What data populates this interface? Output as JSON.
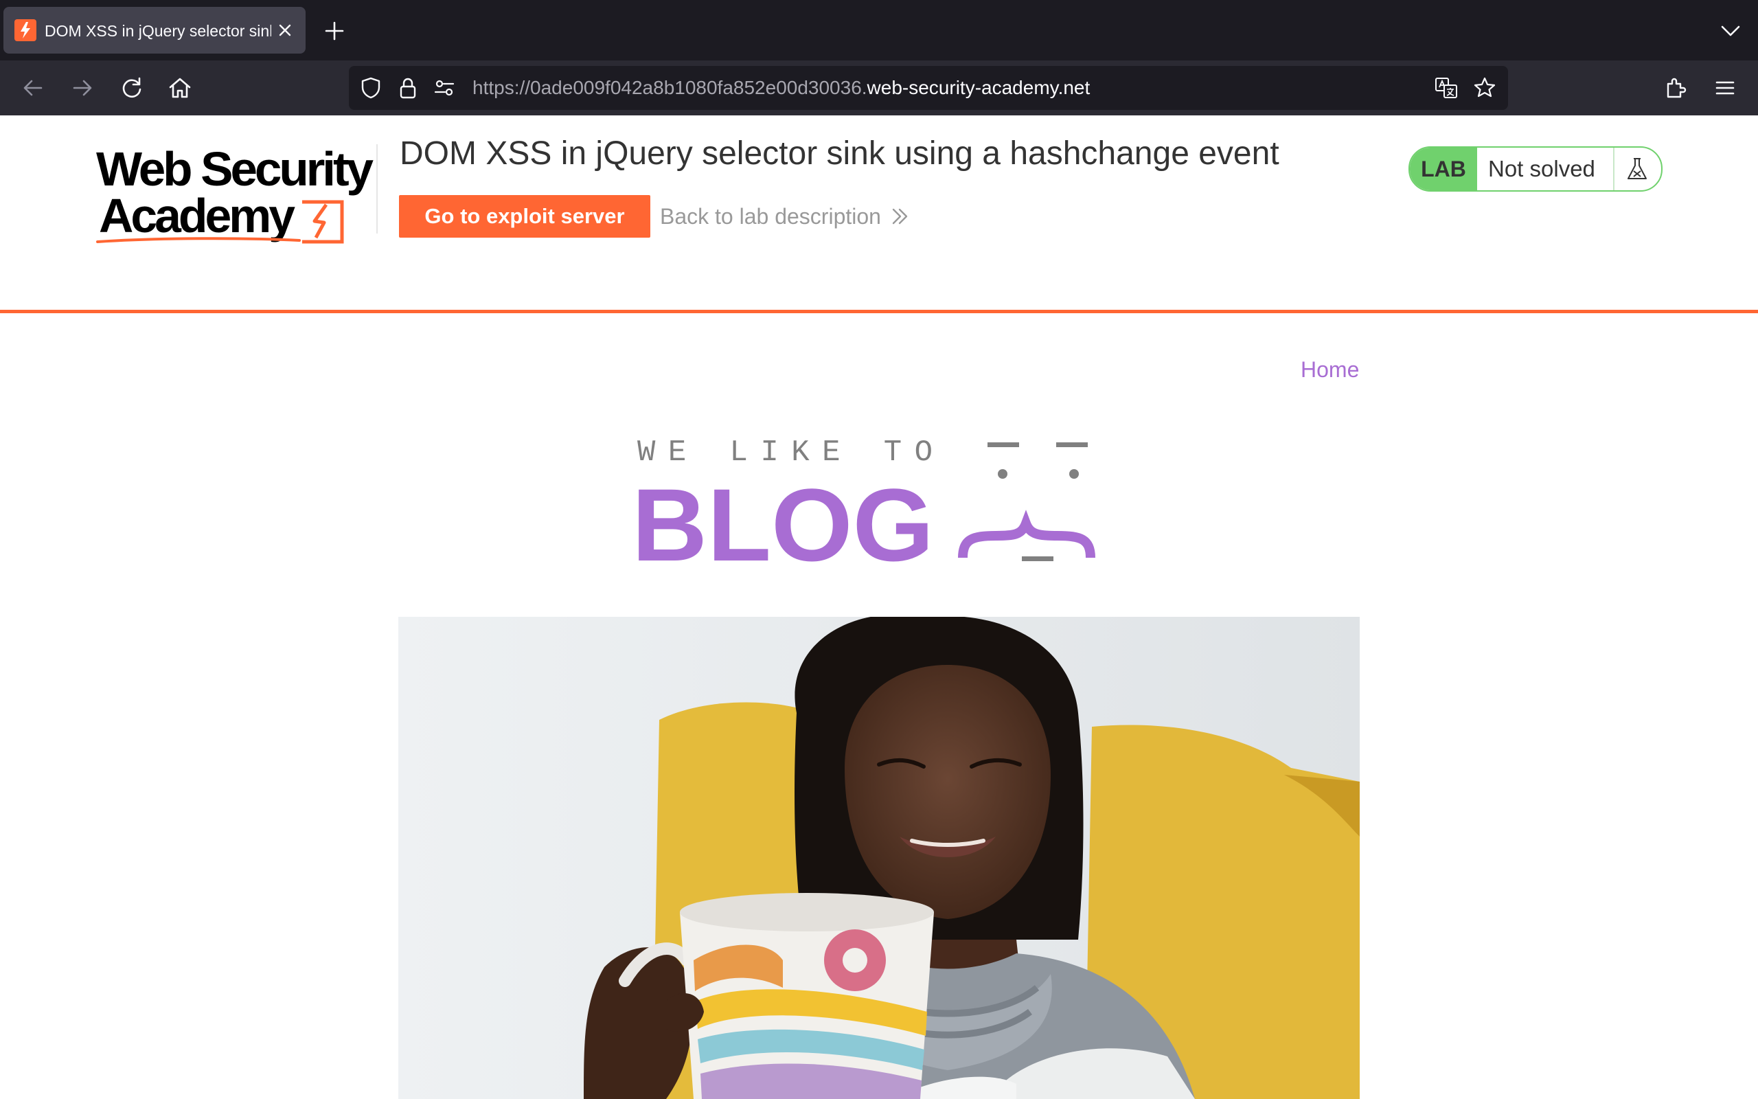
{
  "browser": {
    "tab": {
      "title": "DOM XSS in jQuery selector sink using a hashchange event",
      "favicon": "burp-lightning-icon"
    },
    "url": {
      "prefix": "https://0ade009f042a8b1080fa852e00d30036.",
      "domain": "web-security-academy.net"
    },
    "colors": {
      "tabbar": "#1c1b22",
      "navbar": "#2b2a33",
      "tab": "#42414d"
    }
  },
  "lab": {
    "logo_line1": "Web Security",
    "logo_line2": "Academy",
    "title": "DOM XSS in jQuery selector sink using a hashchange event",
    "exploit_button": "Go to exploit server",
    "back_link": "Back to lab description",
    "status_badge": "LAB",
    "status_text": "Not solved",
    "colors": {
      "accent": "#ff6633",
      "status_green": "#70d16d"
    }
  },
  "blog": {
    "nav_home": "Home",
    "banner_top": "WE LIKE TO",
    "banner_main": "BLOG",
    "colors": {
      "purple": "#a86dd3",
      "grey": "#808080"
    }
  }
}
